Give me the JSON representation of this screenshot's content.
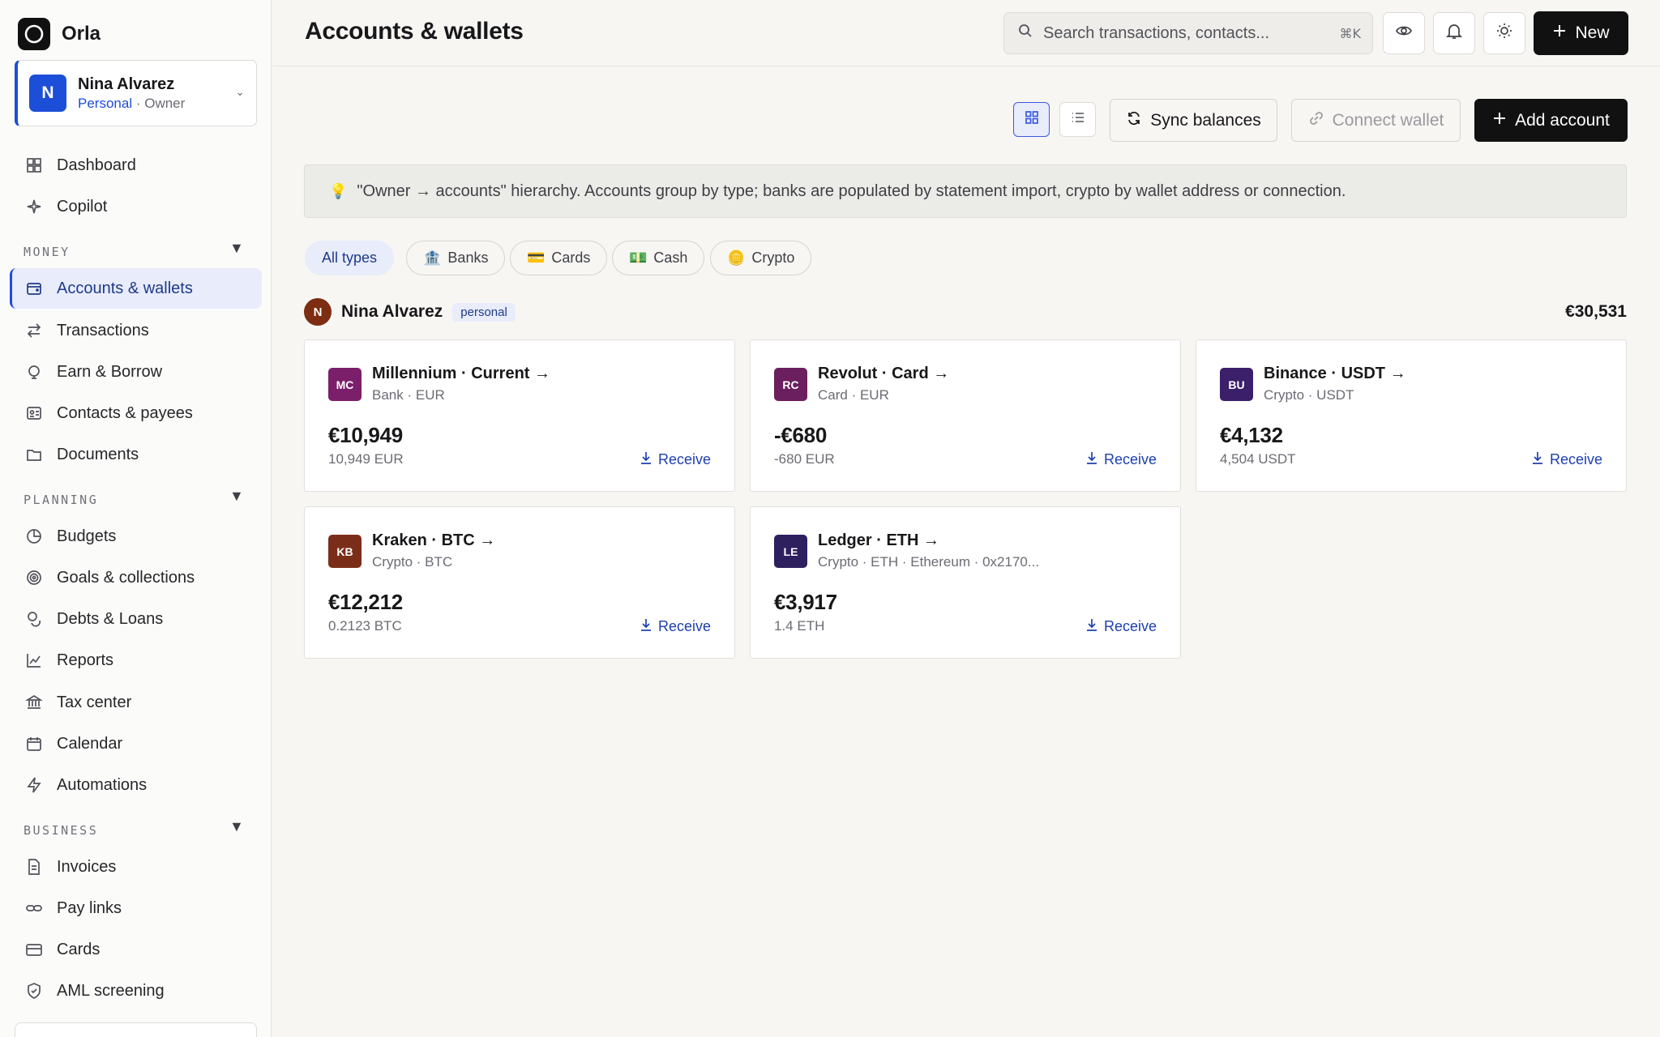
{
  "app": {
    "name": "Orla"
  },
  "owner": {
    "initial": "N",
    "name": "Nina Alvarez",
    "type": "Personal",
    "role": "Owner"
  },
  "nav": {
    "top": [
      {
        "label": "Dashboard",
        "icon": "dashboard-icon"
      },
      {
        "label": "Copilot",
        "icon": "sparkle-icon"
      }
    ],
    "sections": [
      {
        "label": "MONEY",
        "items": [
          "Accounts & wallets",
          "Transactions",
          "Earn & Borrow",
          "Contacts & payees",
          "Documents"
        ]
      },
      {
        "label": "PLANNING",
        "items": [
          "Budgets",
          "Goals & collections",
          "Debts & Loans",
          "Reports",
          "Tax center",
          "Calendar",
          "Automations"
        ]
      },
      {
        "label": "BUSINESS",
        "items": [
          "Invoices",
          "Pay links",
          "Cards",
          "AML screening"
        ]
      }
    ],
    "active": "Accounts & wallets"
  },
  "header": {
    "title": "Accounts & wallets",
    "search_placeholder": "Search transactions, contacts...",
    "search_shortcut": "⌘K",
    "new_label": "New"
  },
  "toolbar": {
    "view_mode": "grid",
    "sync_label": "Sync balances",
    "connect_label": "Connect wallet",
    "add_label": "Add account"
  },
  "banner": {
    "text": "\"Owner → accounts\" hierarchy. Accounts group by type; banks are populated by statement import, crypto by wallet address or connection."
  },
  "filters": [
    {
      "label": "All types",
      "emoji": "",
      "active": true
    },
    {
      "label": "Banks",
      "emoji": "🏦",
      "active": false
    },
    {
      "label": "Cards",
      "emoji": "💳",
      "active": false
    },
    {
      "label": "Cash",
      "emoji": "💵",
      "active": false
    },
    {
      "label": "Crypto",
      "emoji": "🪙",
      "active": false
    }
  ],
  "group": {
    "initial": "N",
    "name": "Nina Alvarez",
    "badge": "personal",
    "total": "€30,531"
  },
  "accounts": [
    {
      "initials": "MC",
      "color": "#7b1f6b",
      "title": "Millennium · Current →",
      "sub": "Bank · EUR",
      "amount": "€10,949",
      "native": "10,949 EUR",
      "action": "Receive"
    },
    {
      "initials": "RC",
      "color": "#6b1f5e",
      "title": "Revolut · Card →",
      "sub": "Card · EUR",
      "amount": "-€680",
      "native": "-680 EUR",
      "action": "Receive"
    },
    {
      "initials": "BU",
      "color": "#3b1f6b",
      "title": "Binance · USDT →",
      "sub": "Crypto · USDT",
      "amount": "€4,132",
      "native": "4,504 USDT",
      "action": "Receive"
    },
    {
      "initials": "KB",
      "color": "#7a2e1a",
      "title": "Kraken · BTC →",
      "sub": "Crypto · BTC",
      "amount": "€12,212",
      "native": "0.2123 BTC",
      "action": "Receive"
    },
    {
      "initials": "LE",
      "color": "#2e1f5e",
      "title": "Ledger · ETH →",
      "sub": "Crypto · ETH · Ethereum · 0x2170...",
      "amount": "€3,917",
      "native": "1.4 ETH",
      "action": "Receive"
    }
  ]
}
